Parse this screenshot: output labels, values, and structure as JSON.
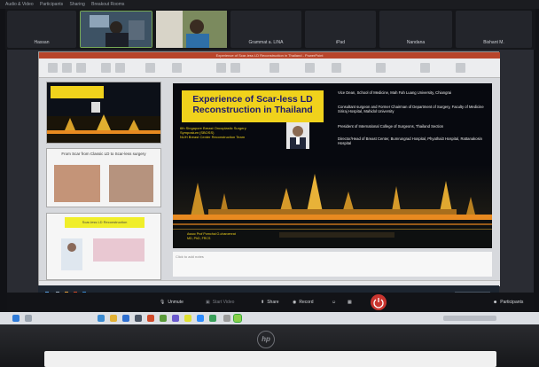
{
  "topstrip": {
    "items": [
      "Audio & Video",
      "Participants",
      "Sharing",
      "Breakout Rooms"
    ]
  },
  "gallery": {
    "tiles": [
      {
        "name": "Hassan"
      },
      {
        "name": ""
      },
      {
        "name": ""
      },
      {
        "name": "Grammat a. LINA"
      },
      {
        "name": "iPad"
      },
      {
        "name": "Nandana"
      },
      {
        "name": "Bishant M."
      }
    ]
  },
  "ppt": {
    "window_title": "Experience of Scar-less LD Reconstruction in Thailand - PowerPoint",
    "thumbnails": {
      "t1_title": "Experience of Scar-less LD Reconstruction in Thailand",
      "t2_title": "From Scar from Classic LD to Scar-less surgery",
      "t3_banner": "Scar-less LD Reconstruction"
    },
    "slide": {
      "title": "Experience of Scar-less LD Reconstruction in Thailand",
      "subtitle_lines": [
        "6th Singapore Breast Oncoplastic Surgery",
        "Symposium (SBOSS)",
        "NUH Breast Center Reconstruction Team"
      ],
      "bullets": [
        "Vice Dean, School of Medicine, Mah Fah Luang University, Chiangrai",
        "Consultant surgeon and Former Chairman of Department of Surgery, Faculty of Medicine Siriraj Hospital, Mahidol University",
        "President of International College of Surgeons, Thailand Section",
        "Director/Head of Breast Center, Bumrungrad Hospital, Phyathai3 Hospital, Rattanakosin Hospital"
      ],
      "caption_lines": [
        "Assoc Prof Pornchai O-charoenrat",
        "MD, PhD, FRCS"
      ]
    },
    "notes_placeholder": "Click to add notes"
  },
  "zoombar": {
    "unmute": "Unmute",
    "start_video": "Start Video",
    "share": "Share",
    "record": "Record",
    "participants": "Participants"
  },
  "colors": {
    "slide_title_bg": "#f0d21c",
    "slide_title_fg": "#1e1a6a",
    "ppt_titlebar": "#b8452b",
    "leave_button": "#c9352f"
  }
}
